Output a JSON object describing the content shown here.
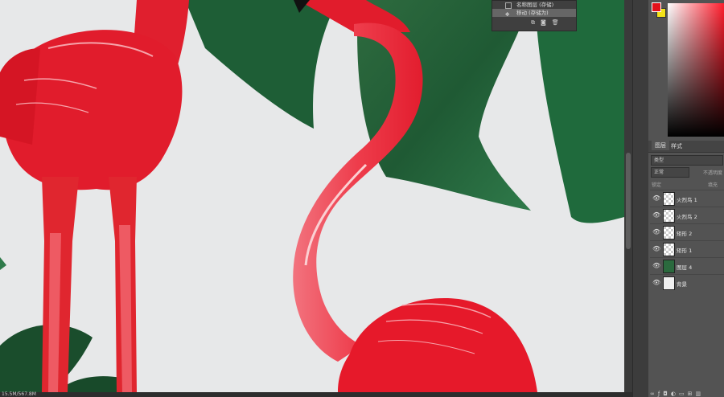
{
  "status": {
    "text": "15.5M/567.8M"
  },
  "history": {
    "items": [
      {
        "label": "名称图层 (存储)",
        "icon": "layer-icon"
      },
      {
        "label": "移动 (存储为)",
        "icon": "move-icon",
        "selected": true
      }
    ],
    "actions": [
      "new-document-icon",
      "camera-icon",
      "trash-icon"
    ]
  },
  "colors": {
    "foreground": "#e3111b",
    "background": "#f3e21a"
  },
  "layers_panel": {
    "tabs": [
      "图层",
      "样式"
    ],
    "filter_label": "类型",
    "blend_mode": "正常",
    "opacity_label": "不透明度",
    "lock_label": "锁定",
    "fill_label": "填充",
    "layers": [
      {
        "name": "火烈鸟 1",
        "visible": true
      },
      {
        "name": "火烈鸟 2",
        "visible": true
      },
      {
        "name": "矩形 2",
        "visible": true
      },
      {
        "name": "矩形 1",
        "visible": true
      },
      {
        "name": "图层 4",
        "visible": true
      },
      {
        "name": "背景",
        "visible": true
      }
    ],
    "bottom_icons": [
      "link-icon",
      "fx-icon",
      "mask-icon",
      "adjustment-icon",
      "folder-icon",
      "new-layer-icon",
      "trash-icon"
    ]
  }
}
